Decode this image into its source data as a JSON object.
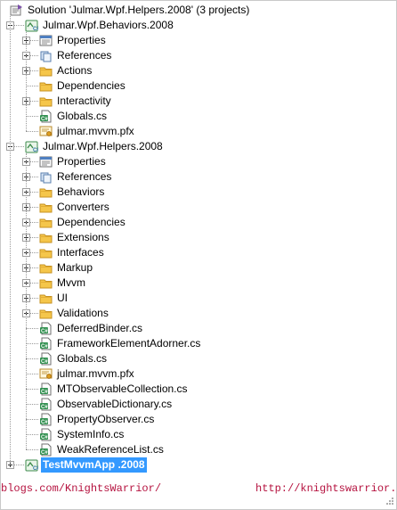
{
  "solution": {
    "label": "Solution 'Julmar.Wpf.Helpers.2008' (3 projects)",
    "icon": "solution-icon"
  },
  "projects": [
    {
      "name": "Julmar.Wpf.Behaviors.2008",
      "expanded": true,
      "selected": false,
      "items": [
        {
          "label": "Properties",
          "icon": "properties-icon",
          "expandable": true
        },
        {
          "label": "References",
          "icon": "references-icon",
          "expandable": true
        },
        {
          "label": "Actions",
          "icon": "folder-icon",
          "expandable": true
        },
        {
          "label": "Dependencies",
          "icon": "folder-icon",
          "expandable": false
        },
        {
          "label": "Interactivity",
          "icon": "folder-icon",
          "expandable": true
        },
        {
          "label": "Globals.cs",
          "icon": "csharp-file-icon",
          "expandable": false
        },
        {
          "label": "julmar.mvvm.pfx",
          "icon": "certificate-icon",
          "expandable": false
        }
      ]
    },
    {
      "name": "Julmar.Wpf.Helpers.2008",
      "expanded": true,
      "selected": false,
      "items": [
        {
          "label": "Properties",
          "icon": "properties-icon",
          "expandable": true
        },
        {
          "label": "References",
          "icon": "references-icon",
          "expandable": true
        },
        {
          "label": "Behaviors",
          "icon": "folder-icon",
          "expandable": true
        },
        {
          "label": "Converters",
          "icon": "folder-icon",
          "expandable": true
        },
        {
          "label": "Dependencies",
          "icon": "folder-icon",
          "expandable": true
        },
        {
          "label": "Extensions",
          "icon": "folder-icon",
          "expandable": true
        },
        {
          "label": "Interfaces",
          "icon": "folder-icon",
          "expandable": true
        },
        {
          "label": "Markup",
          "icon": "folder-icon",
          "expandable": true
        },
        {
          "label": "Mvvm",
          "icon": "folder-icon",
          "expandable": true
        },
        {
          "label": "UI",
          "icon": "folder-icon",
          "expandable": true
        },
        {
          "label": "Validations",
          "icon": "folder-icon",
          "expandable": true
        },
        {
          "label": "DeferredBinder.cs",
          "icon": "csharp-file-icon",
          "expandable": false
        },
        {
          "label": "FrameworkElementAdorner.cs",
          "icon": "csharp-file-icon",
          "expandable": false
        },
        {
          "label": "Globals.cs",
          "icon": "csharp-file-icon",
          "expandable": false
        },
        {
          "label": "julmar.mvvm.pfx",
          "icon": "certificate-icon",
          "expandable": false
        },
        {
          "label": "MTObservableCollection.cs",
          "icon": "csharp-file-icon",
          "expandable": false
        },
        {
          "label": "ObservableDictionary.cs",
          "icon": "csharp-file-icon",
          "expandable": false
        },
        {
          "label": "PropertyObserver.cs",
          "icon": "csharp-file-icon",
          "expandable": false
        },
        {
          "label": "SystemInfo.cs",
          "icon": "csharp-file-icon",
          "expandable": false
        },
        {
          "label": "WeakReferenceList.cs",
          "icon": "csharp-file-icon",
          "expandable": false
        }
      ]
    },
    {
      "name": "TestMvvmApp .2008",
      "expanded": false,
      "selected": true,
      "items": []
    }
  ],
  "watermark": {
    "left": "blogs.com/KnightsWarrior/",
    "right": "http://knightswarrior.bl",
    "color": "#b5123f"
  },
  "colors": {
    "selection": "#3399ff",
    "folder": "#f5c64a",
    "project": "#4aa564"
  }
}
